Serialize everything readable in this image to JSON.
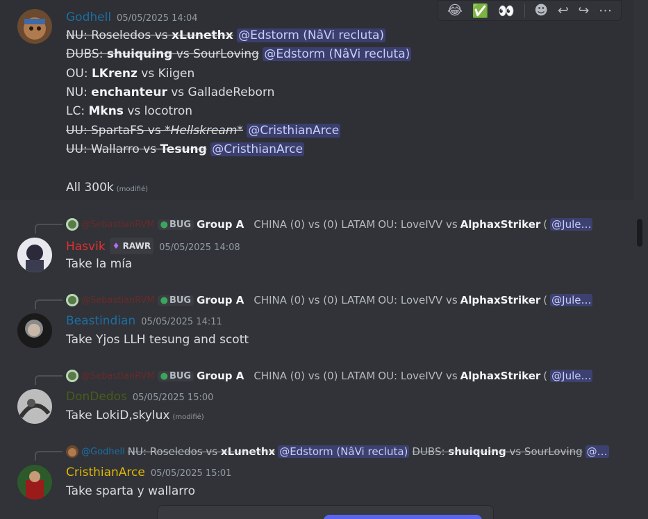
{
  "toolbar": {
    "emoji1": "😂",
    "emoji2": "✅",
    "emoji3": "👀",
    "add_reaction": "☻",
    "reply": "↩",
    "forward": "↪",
    "more": "⋯"
  },
  "msg1": {
    "author": "Godhell",
    "author_color": "#1c6ea4",
    "timestamp": "05/05/2025 14:04",
    "lines": {
      "l1_prefix": "NU: Roseledos vs ",
      "l1_bold": "xLunethx",
      "l1_mention": "@Edstorm (NâVi recluta)",
      "l2_prefix": "DUBS: ",
      "l2_bold": "shuiquing",
      "l2_suffix": " vs SourLoving",
      "l2_mention": "@Edstorm (NâVi recluta)",
      "l3_prefix": "OU: ",
      "l3_bold": "LKrenz",
      "l3_suffix": " vs Kiigen",
      "l4_prefix": "NU: ",
      "l4_bold": "enchanteur",
      "l4_suffix": " vs GalladeReborn",
      "l5_prefix": "LC: ",
      "l5_bold": "Mkns",
      "l5_suffix": " vs locotron",
      "l6_prefix": "UU: SpartaFS vs *",
      "l6_italic": "Hellskream",
      "l6_suffix": "*",
      "l6_mention": "@CristhianArce",
      "l7_prefix": "UU: Wallarro vs ",
      "l7_bold": "Tesung",
      "l7_mention": "@CristhianArce",
      "l8": "All 300k",
      "edited": "(modifié)"
    }
  },
  "reply_common": {
    "author": "@SebastianRVM",
    "tag_label": "BUG",
    "group": "Group A",
    "match": "CHINA (0) vs (0) LATAM",
    "ou_prefix": "OU: LoveIVV vs ",
    "ou_bold": "AlphaxStriker",
    "ou_paren": " (",
    "mention": "@Jule…"
  },
  "msg2": {
    "author": "Hasvik",
    "author_color": "#e03030",
    "badge": "RAWR",
    "timestamp": "05/05/2025 14:08",
    "text": "Take la mía"
  },
  "msg3": {
    "author": "Beastindian",
    "author_color": "#1c6ea4",
    "timestamp": "05/05/2025 14:11",
    "text": "Take Yjos LLH tesung and scott"
  },
  "msg4": {
    "author": "DonDedos",
    "author_color": "#4a5a1a",
    "timestamp": "05/05/2025 15:00",
    "text": "Take LokiD,skylux",
    "edited": "(modifié)"
  },
  "msg5": {
    "reply_author": "@Godhell",
    "reply_prefix": "NU: Roseledos vs ",
    "reply_bold": "xLunethx",
    "reply_mention": "@Edstorm (NâVi recluta)",
    "reply_dubs": "DUBS: ",
    "reply_dubs_bold": "shuiquing",
    "reply_dubs_suffix": " vs SourLoving",
    "reply_mention2": "@…",
    "author": "CristhianArce",
    "author_color": "#e0b800",
    "timestamp": "05/05/2025 15:01",
    "text": "Take sparta y wallarro"
  }
}
